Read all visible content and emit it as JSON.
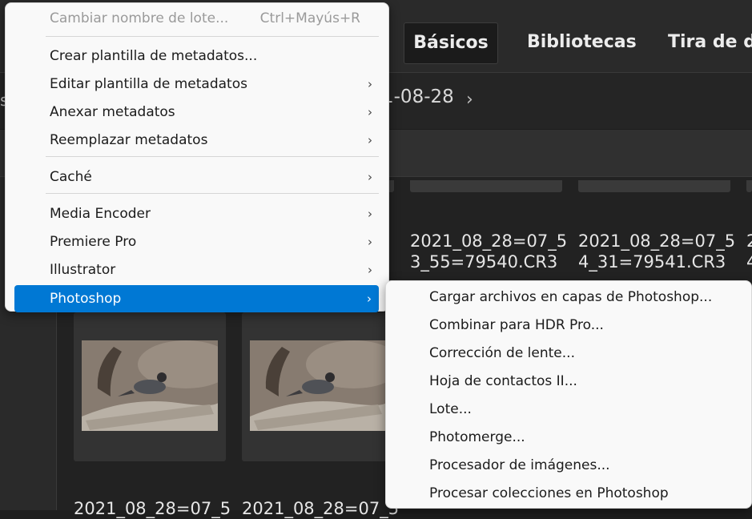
{
  "workspace_tabs": [
    "Básicos",
    "Bibliotecas",
    "Tira de di"
  ],
  "path": {
    "left_fragment": "s",
    "folder": "1-08-28",
    "chevron": "›"
  },
  "files": {
    "row1": [
      {
        "line1": "2021_08_28=07_5",
        "line2": "3_55=79540.CR3"
      },
      {
        "line1": "2021_08_28=07_5",
        "line2": "4_31=79541.CR3"
      },
      {
        "line1": "2",
        "line2": "4"
      }
    ],
    "row2": [
      "2021_08_28=07_5",
      "2021_08_28=07_5"
    ]
  },
  "context_menu": {
    "header_item": {
      "label": "Cambiar nombre de lote...",
      "shortcut": "Ctrl+Mayús+R"
    },
    "group1": [
      {
        "label": "Crear plantilla de metadatos...",
        "has_submenu": false
      },
      {
        "label": "Editar plantilla de metadatos",
        "has_submenu": true
      },
      {
        "label": "Anexar metadatos",
        "has_submenu": true
      },
      {
        "label": "Reemplazar metadatos",
        "has_submenu": true
      }
    ],
    "group2": [
      {
        "label": "Caché",
        "has_submenu": true
      }
    ],
    "group3": [
      {
        "label": "Media Encoder",
        "has_submenu": true
      },
      {
        "label": "Premiere Pro",
        "has_submenu": true
      },
      {
        "label": "Illustrator",
        "has_submenu": true
      },
      {
        "label": "Photoshop",
        "has_submenu": true,
        "active": true
      }
    ],
    "arrow": "›"
  },
  "photoshop_submenu": [
    "Cargar archivos en capas de Photoshop...",
    "Combinar para HDR Pro...",
    "Corrección de lente...",
    "Hoja de contactos II...",
    "Lote...",
    "Photomerge...",
    "Procesador de imágenes...",
    "Procesar colecciones en Photoshop"
  ],
  "colors": {
    "highlight": "#0078d4",
    "menu_bg": "#f9f9f9",
    "app_bg": "#1e1e1e"
  }
}
